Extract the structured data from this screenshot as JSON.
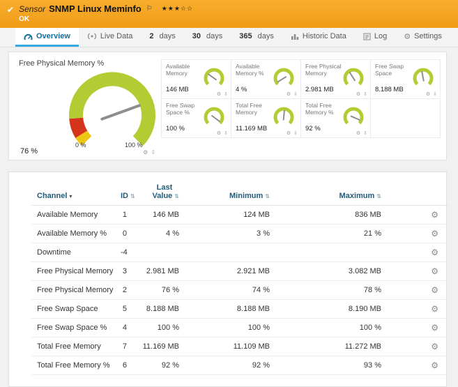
{
  "colors": {
    "accent_orange": "#f5a623",
    "tab_blue": "#38a9e0",
    "gauge_green": "#b4cc34",
    "gauge_red": "#d4331c",
    "gauge_yellow": "#edc713"
  },
  "header": {
    "kind": "Sensor",
    "title": "SNMP Linux Meminfo",
    "status": "OK",
    "stars": "★★★☆☆"
  },
  "tabs": [
    {
      "label": "Overview"
    },
    {
      "label": "Live Data"
    },
    {
      "num": "2",
      "unit": "days"
    },
    {
      "num": "30",
      "unit": "days"
    },
    {
      "num": "365",
      "unit": "days"
    },
    {
      "label": "Historic Data"
    },
    {
      "label": "Log"
    },
    {
      "label": "Settings"
    }
  ],
  "gauges": {
    "default_color": "#b4cc34",
    "primary": {
      "label": "Free Physical Memory %",
      "value": "76 %",
      "min_label": "0 %",
      "max_label": "100 %",
      "pct": 76,
      "segments": [
        {
          "from": 0,
          "to": 5,
          "color": "#edc713"
        },
        {
          "from": 5,
          "to": 15,
          "color": "#d4331c"
        },
        {
          "from": 15,
          "to": 100,
          "color": "#b4cc34"
        }
      ]
    },
    "small": [
      {
        "label": "Available Memory",
        "value": "146 MB",
        "pct": 30
      },
      {
        "label": "Available Memory %",
        "value": "4 %",
        "pct": 5
      },
      {
        "label": "Free Physical Memory",
        "value": "2.981 MB",
        "pct": 38
      },
      {
        "label": "Free Swap Space",
        "value": "8.188 MB",
        "pct": 46
      },
      {
        "label": "Free Swap Space %",
        "value": "100 %",
        "pct": 97
      },
      {
        "label": "Total Free Memory",
        "value": "11.169 MB",
        "pct": 52
      },
      {
        "label": "Total Free Memory %",
        "value": "92 %",
        "pct": 92
      }
    ]
  },
  "table": {
    "headers": {
      "channel": "Channel",
      "id": "ID",
      "last": "Last Value",
      "min": "Minimum",
      "max": "Maximum"
    },
    "rows": [
      {
        "channel": "Available Memory",
        "id": "1",
        "last": "146 MB",
        "min": "124 MB",
        "max": "836 MB"
      },
      {
        "channel": "Available Memory %",
        "id": "0",
        "last": "4 %",
        "min": "3 %",
        "max": "21 %"
      },
      {
        "channel": "Downtime",
        "id": "-4",
        "last": "",
        "min": "",
        "max": ""
      },
      {
        "channel": "Free Physical Memory",
        "id": "3",
        "last": "2.981 MB",
        "min": "2.921 MB",
        "max": "3.082 MB"
      },
      {
        "channel": "Free Physical Memory %",
        "id": "2",
        "last": "76 %",
        "min": "74 %",
        "max": "78 %"
      },
      {
        "channel": "Free Swap Space",
        "id": "5",
        "last": "8.188 MB",
        "min": "8.188 MB",
        "max": "8.190 MB"
      },
      {
        "channel": "Free Swap Space %",
        "id": "4",
        "last": "100 %",
        "min": "100 %",
        "max": "100 %"
      },
      {
        "channel": "Total Free Memory",
        "id": "7",
        "last": "11.169 MB",
        "min": "11.109 MB",
        "max": "11.272 MB"
      },
      {
        "channel": "Total Free Memory %",
        "id": "6",
        "last": "92 %",
        "min": "92 %",
        "max": "93 %"
      }
    ]
  }
}
